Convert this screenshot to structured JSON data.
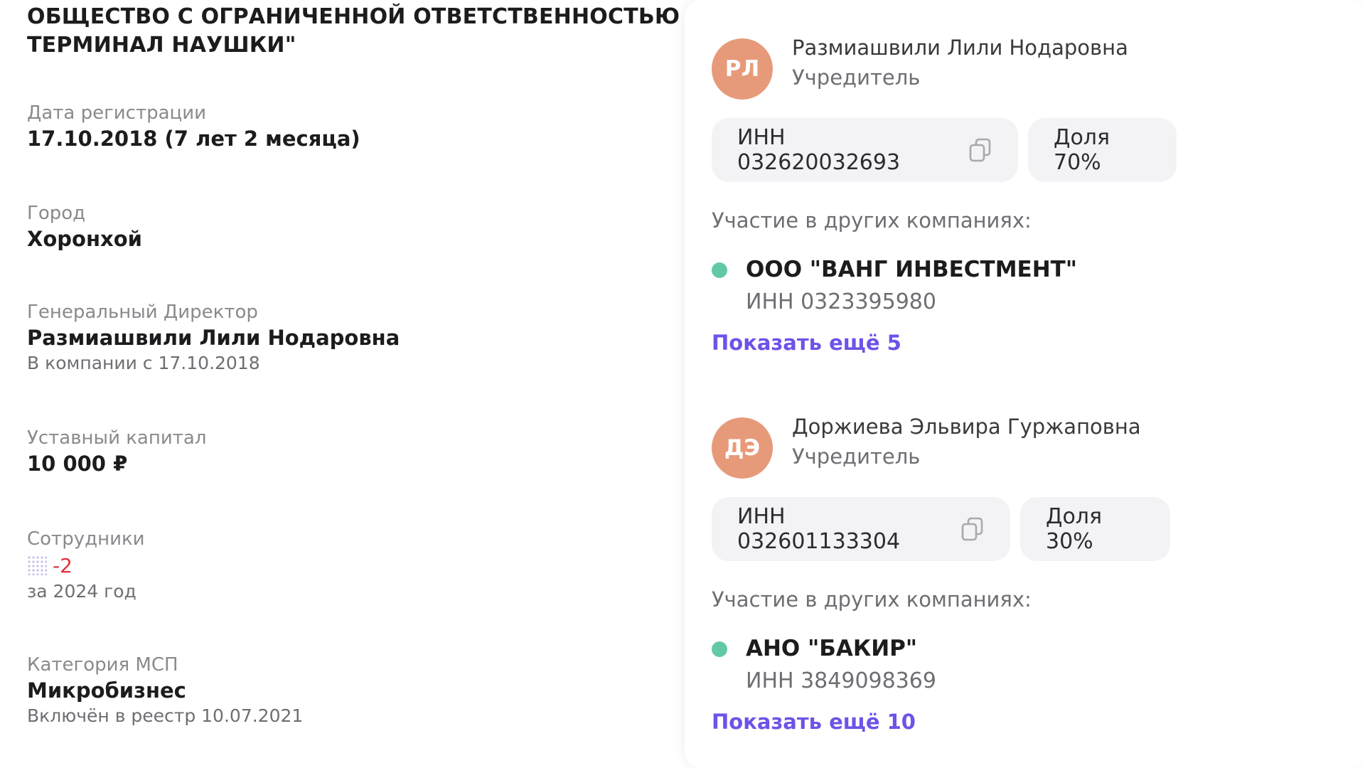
{
  "company": {
    "title": "ОБЩЕСТВО С ОГРАНИЧЕННОЙ ОТВЕТСТВЕННОСТЬЮ \"ЛОГИСТИЧЕСКИЙ ТЕРМИНАЛ НАУШКИ\""
  },
  "fields": {
    "registration": {
      "label": "Дата регистрации",
      "value": "17.10.2018 (7 лет 2 месяца)"
    },
    "city": {
      "label": "Город",
      "value": "Хоронхой"
    },
    "director": {
      "label": "Генеральный Директор",
      "value": "Размиашвили Лили Нодаровна",
      "sub": "В компании с 17.10.2018"
    },
    "capital": {
      "label": "Уставный капитал",
      "value": "10 000 ₽"
    },
    "employees": {
      "label": "Сотрудники",
      "delta": "-2",
      "sub": "за 2024 год"
    },
    "msp": {
      "label": "Категория МСП",
      "value": "Микробизнес",
      "sub": "Включён в реестр 10.07.2021"
    }
  },
  "founders": [
    {
      "initials": "РЛ",
      "name": "Размиашвили Лили Нодаровна",
      "role": "Учредитель",
      "inn": "ИНН 032620032693",
      "share": "Доля 70%",
      "participation_label": "Участие в других компаниях:",
      "companies": [
        {
          "name": "ООО \"ВАНГ ИНВЕСТМЕНТ\"",
          "inn": "ИНН 0323395980"
        }
      ],
      "show_more": "Показать ещё 5"
    },
    {
      "initials": "ДЭ",
      "name": "Доржиева Эльвира Гуржаповна",
      "role": "Учредитель",
      "inn": "ИНН 032601133304",
      "share": "Доля 30%",
      "participation_label": "Участие в других компаниях:",
      "companies": [
        {
          "name": "АНО \"БАКИР\"",
          "inn": "ИНН 3849098369"
        }
      ],
      "show_more": "Показать ещё 10"
    }
  ],
  "colors": {
    "avatar": "#e79a7a",
    "link": "#6f52e8",
    "status_dot": "#62c8a8",
    "negative": "#e0303a"
  },
  "icons": {
    "copy": "copy-icon",
    "employees_indicator": "dots-icon"
  }
}
